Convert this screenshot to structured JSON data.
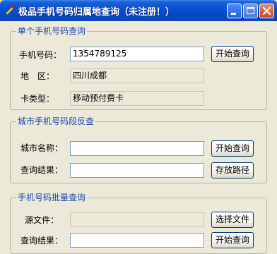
{
  "window": {
    "title": "极品手机号码归属地查询（未注册！）"
  },
  "single_query": {
    "group_title": "单个手机号码查询",
    "phone_label": "手机号码：",
    "phone_value": "1354789125",
    "area_label": "地　区：",
    "area_value": "四川成都",
    "card_type_label": "卡类型：",
    "card_type_value": "移动预付费卡",
    "start_button": "开始查询"
  },
  "city_lookup": {
    "group_title": "城市手机号码段反查",
    "city_label": "城市名称：",
    "city_value": "",
    "result_label": "查询结果：",
    "result_value": "",
    "start_button": "开始查询",
    "save_path_button": "存放路径"
  },
  "batch_query": {
    "group_title": "手机号码批量查询",
    "source_label": "源文件：",
    "source_value": "",
    "result_label": "查询结果：",
    "result_value": "",
    "choose_file_button": "选择文件",
    "start_button": "开始查询"
  }
}
